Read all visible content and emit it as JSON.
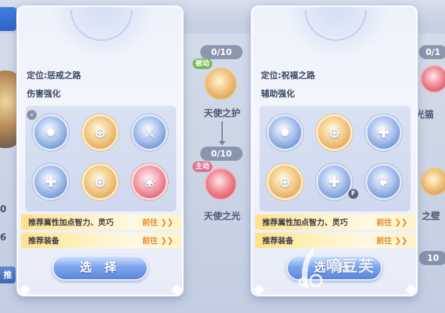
{
  "background": {
    "stats": [
      "0",
      "6"
    ],
    "left_button_label": "推",
    "skill_tree": {
      "counters": [
        "0/10",
        "0/10"
      ],
      "nodes": [
        {
          "label": "天使之护",
          "tag": "被动"
        },
        {
          "label": "天使之光",
          "tag": "主动"
        }
      ]
    },
    "right_counters": [
      "0/1",
      "10"
    ],
    "right_labels": [
      "光猫",
      "之壁"
    ]
  },
  "cards": [
    {
      "position": "定位:惩戒之路",
      "focus": "伤害强化",
      "talents": [
        {
          "style": "blue",
          "icon": "starburst-icon"
        },
        {
          "style": "gold",
          "icon": "crest-icon"
        },
        {
          "style": "blue",
          "icon": "sword-icon"
        },
        {
          "style": "blue",
          "icon": "cross-icon"
        },
        {
          "style": "gold",
          "icon": "shield-icon"
        },
        {
          "style": "red",
          "icon": "flame-icon"
        }
      ],
      "recommend_stats": "推荐属性加点智力、灵巧",
      "recommend_gear": "推荐装备",
      "go_label": "前往 ❯❯",
      "select_label": "选 择"
    },
    {
      "position": "定位:祝福之路",
      "focus": "辅助强化",
      "talents": [
        {
          "style": "blue",
          "icon": "starburst-icon"
        },
        {
          "style": "gold",
          "icon": "crest-icon"
        },
        {
          "style": "blue",
          "icon": "cross-icon"
        },
        {
          "style": "gold",
          "icon": "shield-icon"
        },
        {
          "style": "blue",
          "icon": "heal-icon"
        },
        {
          "style": "blue",
          "icon": "wing-icon"
        }
      ],
      "recommend_stats": "推荐属性加点智力、灵巧",
      "recommend_gear": "推荐装备",
      "go_label": "前往 ❯❯",
      "select_label": "选 择"
    }
  ],
  "badges": {
    "minus": "-",
    "f": "F"
  },
  "watermark": "嘀豆芙",
  "colors": {
    "accent_blue": "#5b85db",
    "go_orange": "#e08a2a",
    "rec_yellow": "#ffe18a"
  }
}
